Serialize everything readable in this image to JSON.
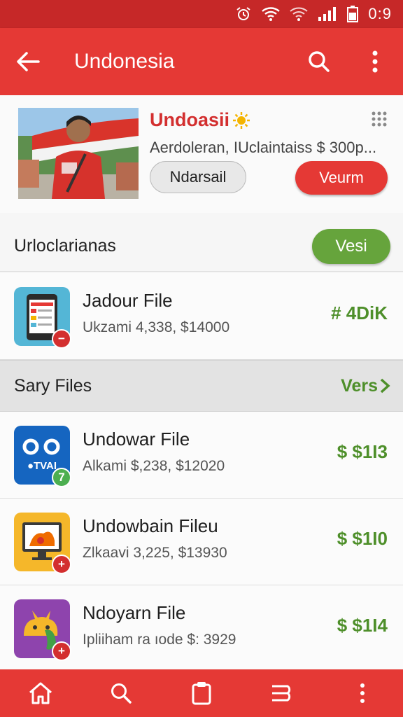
{
  "status": {
    "time": "0:9"
  },
  "app_bar": {
    "title": "Undonesia"
  },
  "profile": {
    "name": "Undoasii",
    "description": "Aerdoleran, IUclaintaiss $ 300p...",
    "secondary_button": "Ndarsail",
    "primary_button": "Veurm"
  },
  "section1": {
    "title": "Urloclarianas",
    "button": "Vesi"
  },
  "section2": {
    "title": "Sary Files",
    "link": "Vers"
  },
  "items": [
    {
      "name": "Jadour File",
      "meta": "Ukzami 4,338, $14000",
      "price": "# 4DiK",
      "icon": "phone-app-icon",
      "badge": "−"
    },
    {
      "name": "Undowar File",
      "meta": "Alkami $,238, $12020",
      "price": "$ $1I3",
      "icon": "tv-app-icon",
      "badge": "7"
    },
    {
      "name": "Undowbain Fileu",
      "meta": "Zlkaavi 3,225, $13930",
      "price": "$ $1I0",
      "icon": "monitor-app-icon",
      "badge": "+"
    },
    {
      "name": "Ndoyarn File",
      "meta": "Ipliiham ra ıode $: 3929",
      "price": "$ $1I4",
      "icon": "android-app-icon",
      "badge": "+"
    }
  ],
  "colors": {
    "primary": "#e53935",
    "primary_dark": "#c62828",
    "accent_green": "#66a43c",
    "price_green": "#4e8f2a"
  }
}
